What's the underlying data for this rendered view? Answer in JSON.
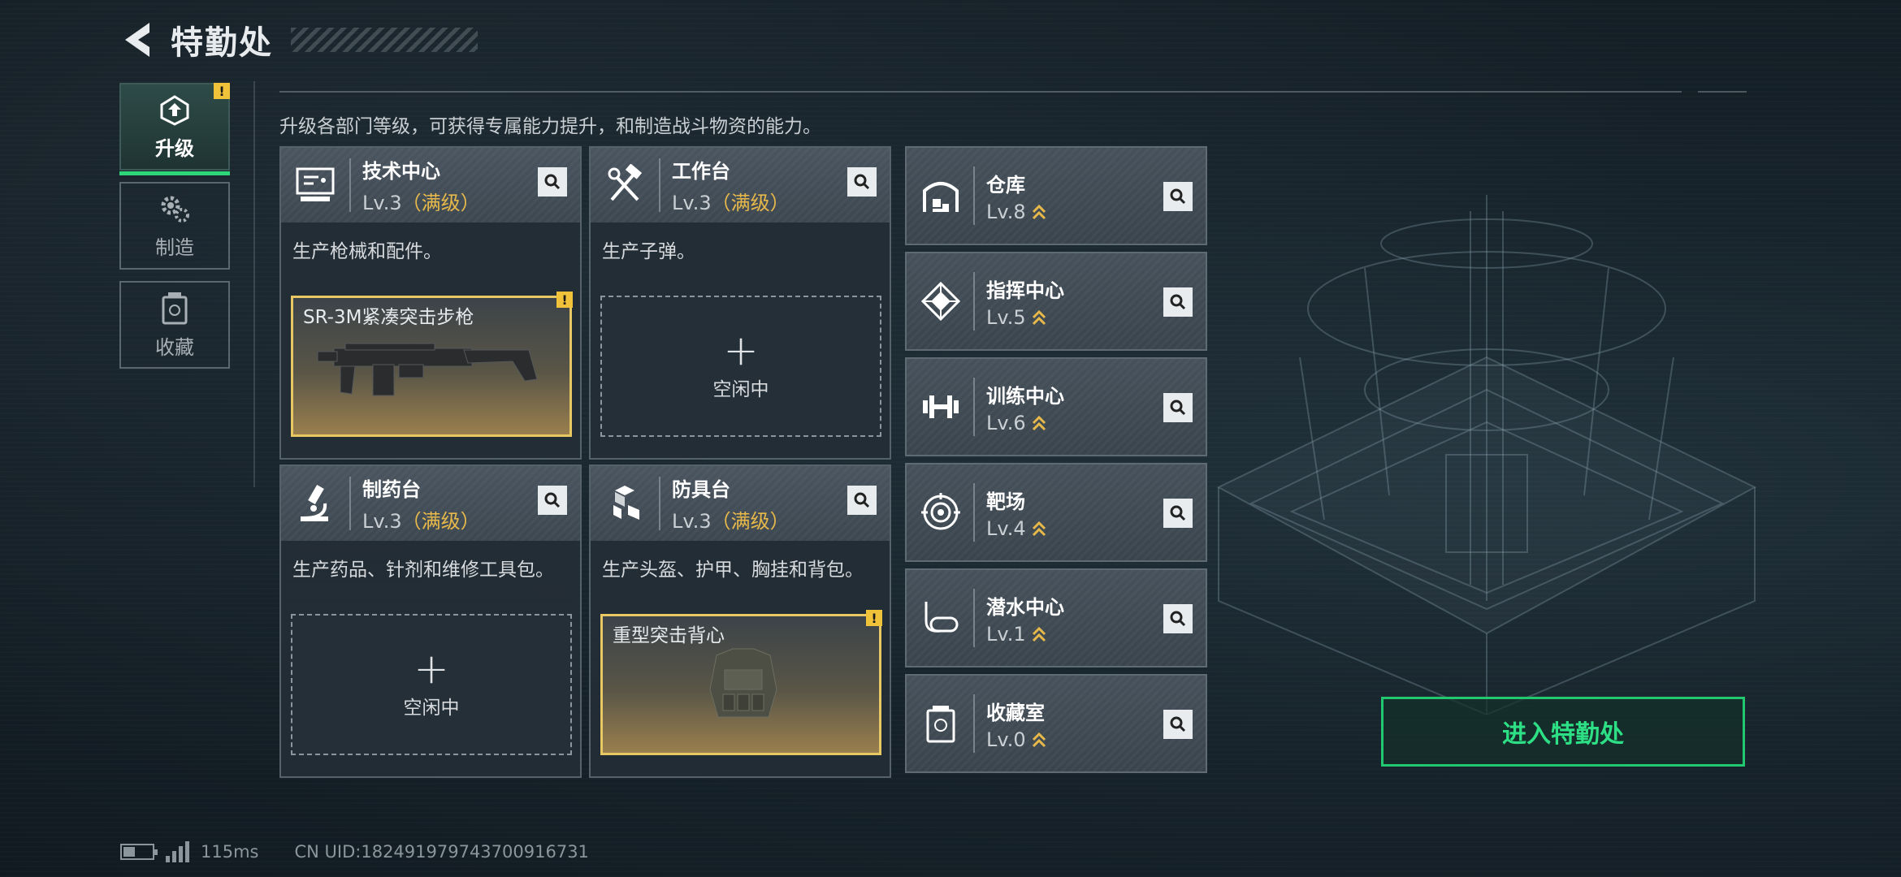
{
  "header": {
    "title": "特勤处"
  },
  "side_tabs": [
    {
      "label": "升级",
      "active": true,
      "alert": "!"
    },
    {
      "label": "制造",
      "active": false
    },
    {
      "label": "收藏",
      "active": false
    }
  ],
  "intro": "升级各部门等级，可获得专属能力提升，和制造战斗物资的能力。",
  "big_cards": [
    {
      "name": "技术中心",
      "lv": "Lv.3",
      "max": "（满级）",
      "desc": "生产枪械和配件。",
      "slot": {
        "type": "filled",
        "item": "SR-3M紧凑突击步枪",
        "alert": "!"
      }
    },
    {
      "name": "工作台",
      "lv": "Lv.3",
      "max": "（满级）",
      "desc": "生产子弹。",
      "slot": {
        "type": "empty",
        "plus": "+",
        "idle": "空闲中"
      }
    },
    {
      "name": "制药台",
      "lv": "Lv.3",
      "max": "（满级）",
      "desc": "生产药品、针剂和维修工具包。",
      "slot": {
        "type": "empty",
        "plus": "+",
        "idle": "空闲中"
      }
    },
    {
      "name": "防具台",
      "lv": "Lv.3",
      "max": "（满级）",
      "desc": "生产头盔、护甲、胸挂和背包。",
      "slot": {
        "type": "filled",
        "item": "重型突击背心",
        "alert": "!"
      }
    }
  ],
  "small_cards": [
    {
      "name": "仓库",
      "lv": "Lv.8"
    },
    {
      "name": "指挥中心",
      "lv": "Lv.5"
    },
    {
      "name": "训练中心",
      "lv": "Lv.6"
    },
    {
      "name": "靶场",
      "lv": "Lv.4"
    },
    {
      "name": "潜水中心",
      "lv": "Lv.1"
    },
    {
      "name": "收藏室",
      "lv": "Lv.0"
    }
  ],
  "enter_button": "进入特勤处",
  "status": {
    "ping": "115ms",
    "uid": "CN UID:182491979743700916731"
  },
  "colors": {
    "accent_green": "#2ed67a",
    "max_gold": "#e7b84a",
    "alert_yellow": "#f0c23a"
  }
}
